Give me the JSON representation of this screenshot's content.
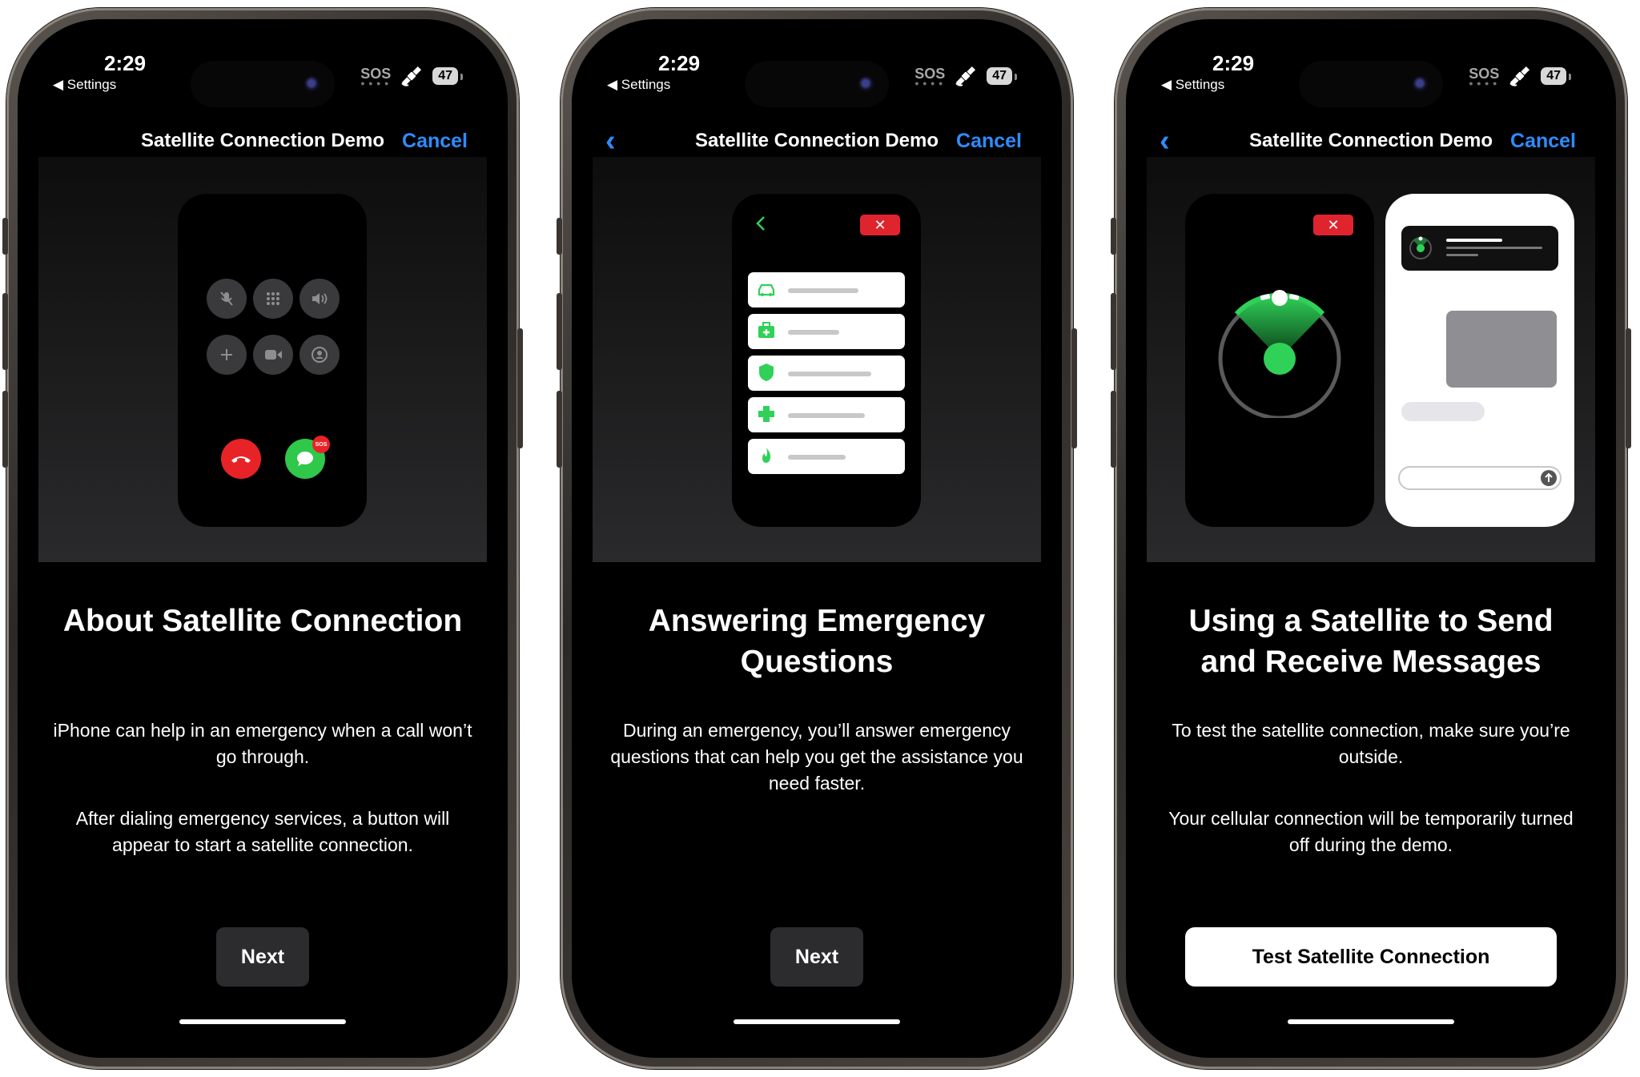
{
  "status_bar": {
    "time": "2:29",
    "back_label": "◀ Settings",
    "sos_label": "SOS",
    "battery": "47"
  },
  "colors": {
    "accent_blue": "#2e8cff",
    "end_red": "#e82327",
    "accept_green": "#2fc84a",
    "sat_green": "#30d158"
  },
  "screens": [
    {
      "nav": {
        "title": "Satellite Connection Demo",
        "cancel": "Cancel"
      },
      "heading": "About Satellite Connection",
      "paragraphs": [
        "iPhone can help in an emergency when a call won’t go through.",
        "After dialing emergency services, a button will appear to start a satellite connection."
      ],
      "button": "Next",
      "illustration": {
        "badge": "SOS",
        "icons": [
          "mute-icon",
          "keypad-icon",
          "speaker-icon",
          "add-call-icon",
          "facetime-icon",
          "contacts-icon",
          "end-call-icon",
          "message-icon"
        ]
      }
    },
    {
      "nav": {
        "title": "Satellite Connection Demo",
        "cancel": "Cancel",
        "back": "‹"
      },
      "heading": "Answering Emergency Questions",
      "paragraphs": [
        "During an emergency, you’ll answer emergency questions that can help you get the assistance you need faster."
      ],
      "button": "Next",
      "illustration": {
        "close": "✕",
        "icons": [
          "car-icon",
          "medical-bag-icon",
          "shield-icon",
          "medical-cross-icon",
          "fire-icon"
        ]
      }
    },
    {
      "nav": {
        "title": "Satellite Connection Demo",
        "cancel": "Cancel",
        "back": "‹"
      },
      "heading": "Using a Satellite to Send and Receive Messages",
      "paragraphs": [
        "To test the satellite connection, make sure you’re outside.",
        "Your cellular connection will be temporarily turned off during the demo."
      ],
      "button": "Test Satellite Connection",
      "illustration": {
        "close": "✕",
        "icons": [
          "satellite-icon",
          "send-arrow-icon"
        ]
      }
    }
  ]
}
